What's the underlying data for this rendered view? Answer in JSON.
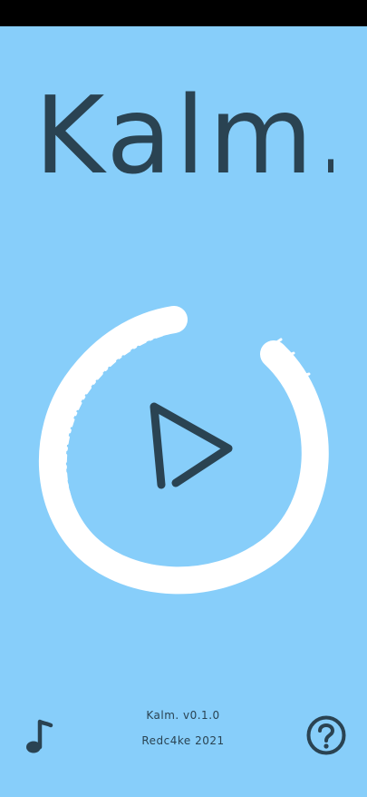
{
  "app": {
    "title": "Kalm.",
    "version": "Kalm. v0.1.0",
    "credit": "Redc4ke 2021"
  },
  "icons": {
    "play": "play-icon",
    "music": "music-note-icon",
    "help": "question-mark-icon"
  },
  "colors": {
    "background": "#87CEFA",
    "ink": "#2A4352",
    "ring": "#FFFFFF",
    "status_bar": "#000000"
  }
}
